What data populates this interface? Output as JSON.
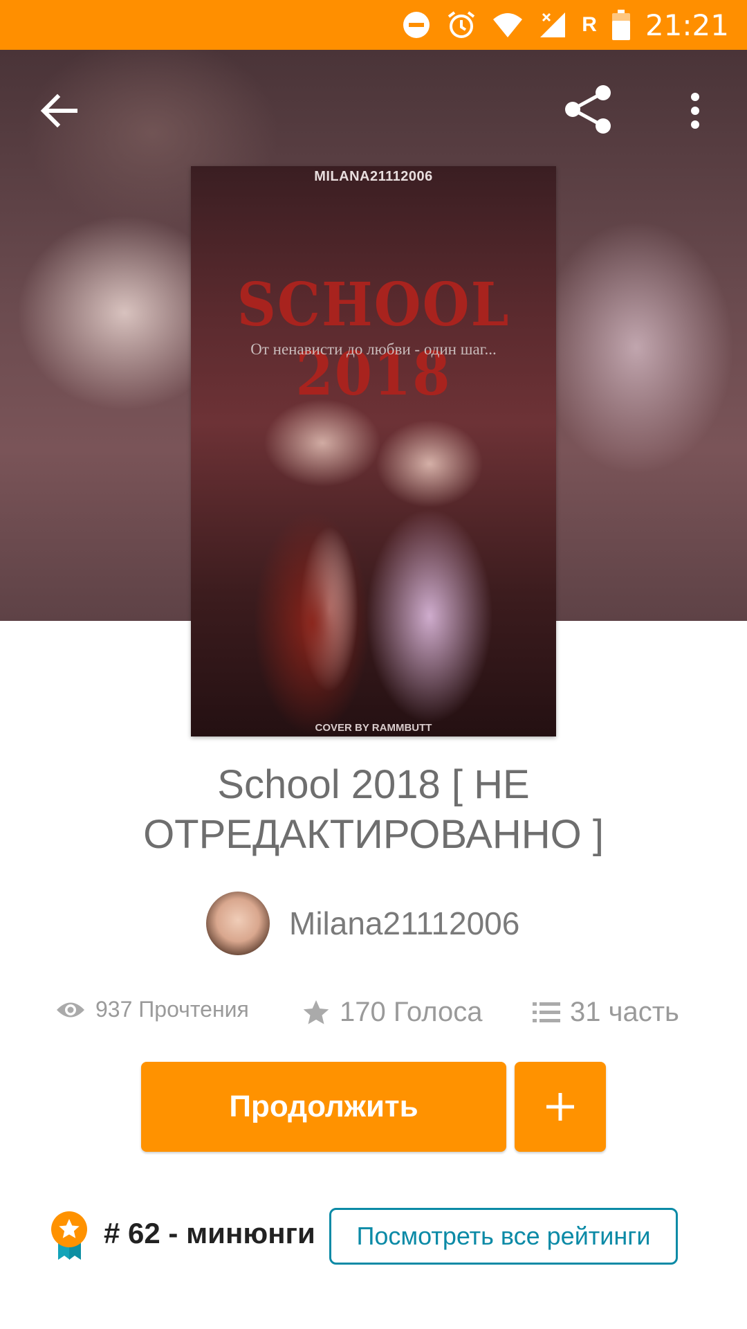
{
  "status_bar": {
    "time": "21:21",
    "network_label": "R",
    "icons": [
      "do-not-disturb-icon",
      "alarm-icon",
      "wifi-icon",
      "signal-icon",
      "battery-icon"
    ]
  },
  "toolbar": {
    "back_icon": "arrow-left-icon",
    "share_icon": "share-icon",
    "more_icon": "more-vert-icon"
  },
  "cover": {
    "author_text": "MILANA21112006",
    "title_text": "SCHOOL 2018",
    "subtitle_text": "От ненависти до любви - один шаг...",
    "credit_text": "COVER BY RAMMBUTT"
  },
  "story": {
    "title": "School 2018 [ НЕ ОТРЕДАКТИРОВАННО ]",
    "author": "Milana21112006"
  },
  "stats": {
    "reads": "937 Прочтения",
    "votes": "170 Голоса",
    "parts": "31 часть"
  },
  "actions": {
    "continue_label": "Продолжить",
    "add_label": "+"
  },
  "ranking": {
    "text": "# 62 - минюнги",
    "view_all_label": "Посмотреть все рейтинги"
  },
  "colors": {
    "accent": "#ff9200",
    "status_bar": "#ff8f00",
    "link": "#0b8aa6"
  }
}
